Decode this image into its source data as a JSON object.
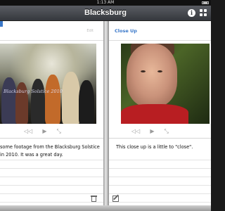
{
  "status_bar": {
    "time": "1:13 AM"
  },
  "nav_bar": {
    "title": "Blacksburg",
    "info_icon": "info-icon",
    "grid_icon": "grid-icon"
  },
  "left_page": {
    "edit_label": "Edit",
    "video": {
      "watermark": "Blacksburg Solstice 2010"
    },
    "caption": "some footage from the Blacksburg Solstice in 2010. It was a great day."
  },
  "right_page": {
    "title": "Close Up",
    "caption": "This close up is a little to \"close\"."
  },
  "controls": [
    "rewind-icon",
    "play-icon",
    "expand-icon"
  ],
  "colors": {
    "accent": "#3a78c9",
    "nav_bar": "#46494e"
  }
}
